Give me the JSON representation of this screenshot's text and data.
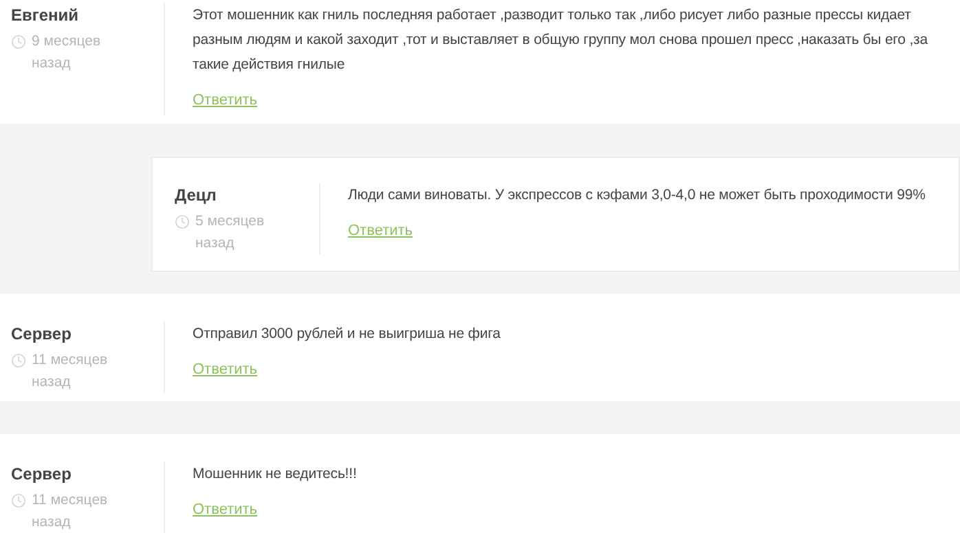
{
  "comments": [
    {
      "author": "Евгений",
      "time": "9 месяцев назад",
      "text": "Этот мошенник как гниль последняя работает ,разводит только так ,либо рисует либо разные прессы кидает разным людям и какой заходит ,тот и выставляет в общую группу мол снова прошел пресс ,наказать бы его ,за такие действия гнилые",
      "reply_link": "Ответить",
      "replies": [
        {
          "author": "Децл",
          "time": "5 месяцев назад",
          "text": "Люди сами виноваты. У экспрессов с кэфами 3,0-4,0 не может быть проходимости 99%",
          "reply_link": "Ответить"
        }
      ]
    },
    {
      "author": "Сервер",
      "time": "11 месяцев назад",
      "text": "Отправил 3000 рублей и не выигриша не фига",
      "reply_link": "Ответить"
    },
    {
      "author": "Сервер",
      "time": "11 месяцев назад",
      "text": "Мошенник не ведитесь!!!",
      "reply_link": "Ответить"
    }
  ]
}
